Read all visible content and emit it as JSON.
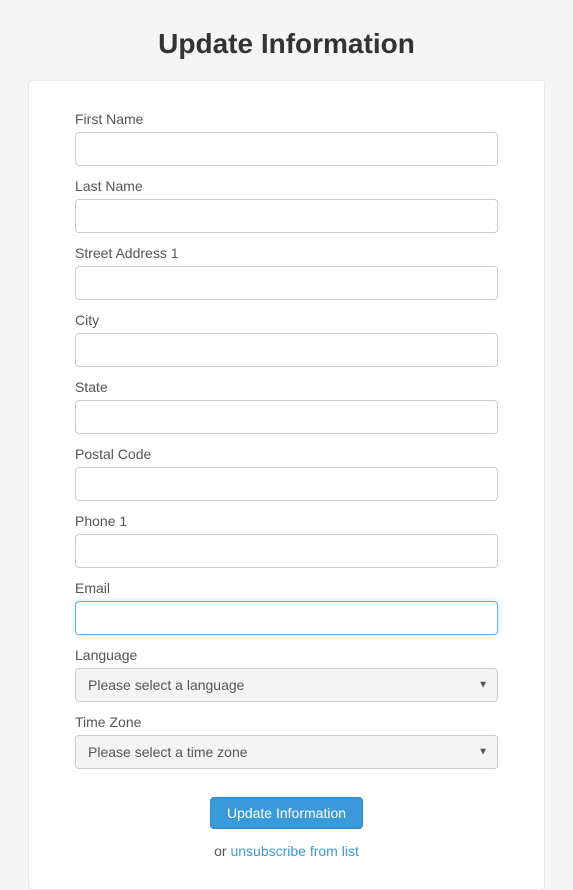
{
  "title": "Update Information",
  "form": {
    "first_name": {
      "label": "First Name",
      "value": ""
    },
    "last_name": {
      "label": "Last Name",
      "value": ""
    },
    "street1": {
      "label": "Street Address 1",
      "value": ""
    },
    "city": {
      "label": "City",
      "value": ""
    },
    "state": {
      "label": "State",
      "value": ""
    },
    "postal": {
      "label": "Postal Code",
      "value": ""
    },
    "phone1": {
      "label": "Phone 1",
      "value": ""
    },
    "email": {
      "label": "Email",
      "value": "",
      "focused": true
    },
    "language": {
      "label": "Language",
      "selected": "Please select a language"
    },
    "timezone": {
      "label": "Time Zone",
      "selected": "Please select a time zone"
    }
  },
  "actions": {
    "submit": "Update Information",
    "or_text": "or ",
    "unsubscribe": "unsubscribe from list"
  }
}
